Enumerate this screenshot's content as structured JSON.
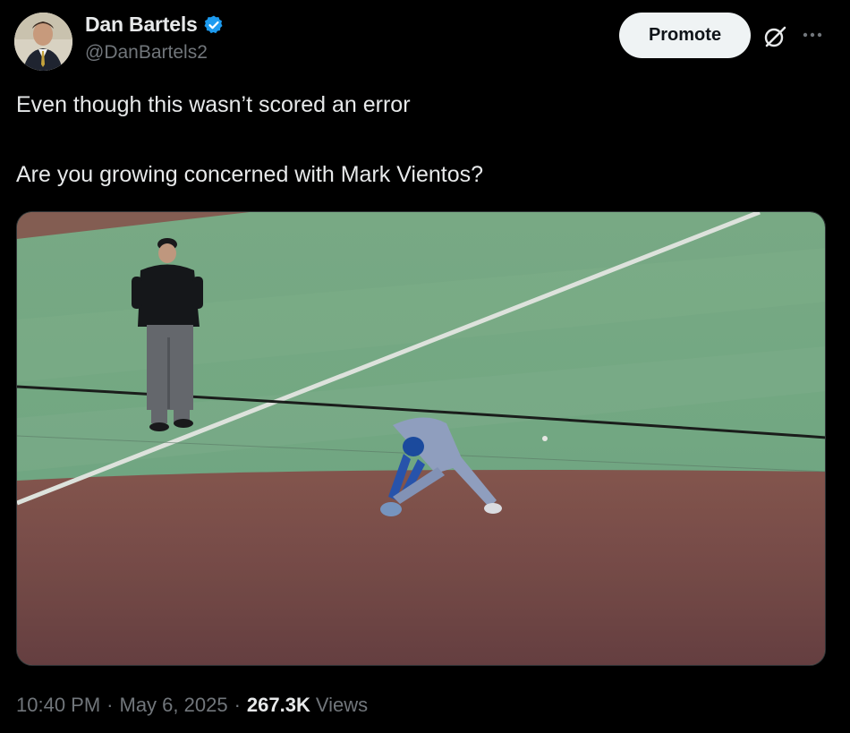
{
  "author": {
    "display_name": "Dan Bartels",
    "handle": "@DanBartels2",
    "verified": true,
    "verified_color": "#1d9bf0"
  },
  "actions": {
    "promote_label": "Promote",
    "grok_icon": "grok-slash-circle-icon",
    "more_icon": "more-horizontal-icon"
  },
  "tweet": {
    "text": "Even though this wasn’t scored an error\n\nAre you growing concerned with Mark Vientos?"
  },
  "media": {
    "type": "video-frame",
    "subject": "baseball infield play"
  },
  "meta": {
    "time": "10:40 PM",
    "date": "May 6, 2025",
    "views_count": "267.3K",
    "views_label": "Views",
    "separator": "·"
  }
}
